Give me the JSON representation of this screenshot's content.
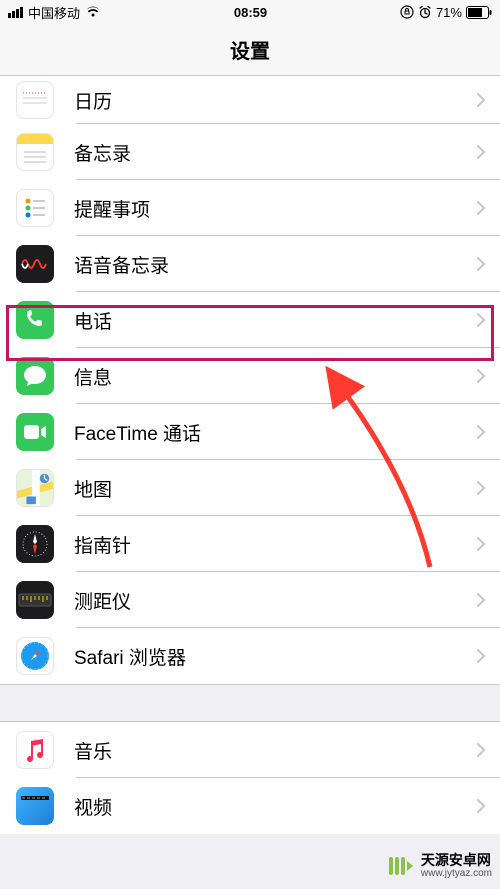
{
  "status": {
    "carrier": "中国移动",
    "time": "08:59",
    "battery": "71%"
  },
  "header": {
    "title": "设置"
  },
  "section1": [
    {
      "id": "calendar",
      "label": "日历"
    },
    {
      "id": "notes",
      "label": "备忘录"
    },
    {
      "id": "reminders",
      "label": "提醒事项"
    },
    {
      "id": "voicememo",
      "label": "语音备忘录"
    },
    {
      "id": "phone",
      "label": "电话"
    },
    {
      "id": "messages",
      "label": "信息"
    },
    {
      "id": "facetime",
      "label": "FaceTime 通话"
    },
    {
      "id": "maps",
      "label": "地图"
    },
    {
      "id": "compass",
      "label": "指南针"
    },
    {
      "id": "measure",
      "label": "测距仪"
    },
    {
      "id": "safari",
      "label": "Safari 浏览器"
    }
  ],
  "section2": [
    {
      "id": "music",
      "label": "音乐"
    },
    {
      "id": "video",
      "label": "视频"
    }
  ],
  "highlight": {
    "color": "#c2185b",
    "targetId": "phone"
  },
  "watermark": {
    "line1": "天源安卓网",
    "line2": "www.jytyaz.com"
  }
}
